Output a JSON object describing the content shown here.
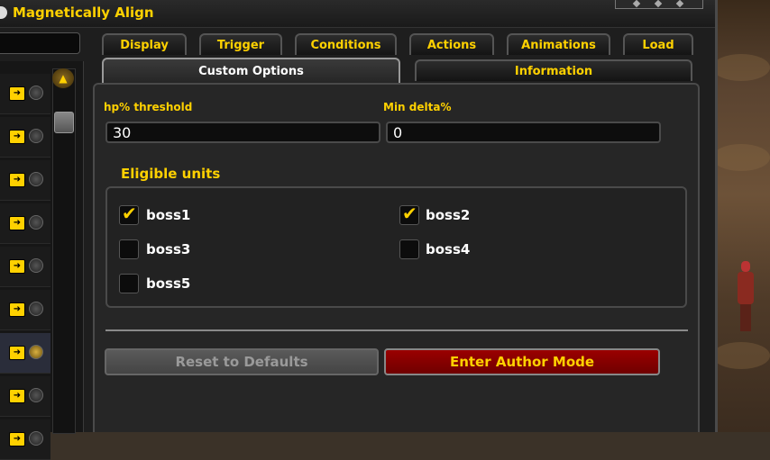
{
  "window": {
    "title": "Magnetically Align"
  },
  "tabs_row1": [
    {
      "label": "Display"
    },
    {
      "label": "Trigger"
    },
    {
      "label": "Conditions"
    },
    {
      "label": "Actions"
    },
    {
      "label": "Animations"
    },
    {
      "label": "Load"
    }
  ],
  "tabs_row2": [
    {
      "label": "Custom Options",
      "active": true
    },
    {
      "label": "Information",
      "active": false
    }
  ],
  "fields": {
    "hp_threshold": {
      "label": "hp% threshold",
      "value": "30"
    },
    "min_delta": {
      "label": "Min delta%",
      "value": "0"
    }
  },
  "eligible": {
    "title": "Eligible units",
    "units": [
      {
        "label": "boss1",
        "checked": true
      },
      {
        "label": "boss2",
        "checked": true
      },
      {
        "label": "boss3",
        "checked": false
      },
      {
        "label": "boss4",
        "checked": false
      },
      {
        "label": "boss5",
        "checked": false
      }
    ]
  },
  "buttons": {
    "reset": "Reset to Defaults",
    "author": "Enter Author Mode"
  },
  "left_list": {
    "selected_index": 6,
    "gold_index": 6,
    "count": 9
  },
  "colors": {
    "accent": "#ffd100",
    "danger": "#8a0000"
  }
}
